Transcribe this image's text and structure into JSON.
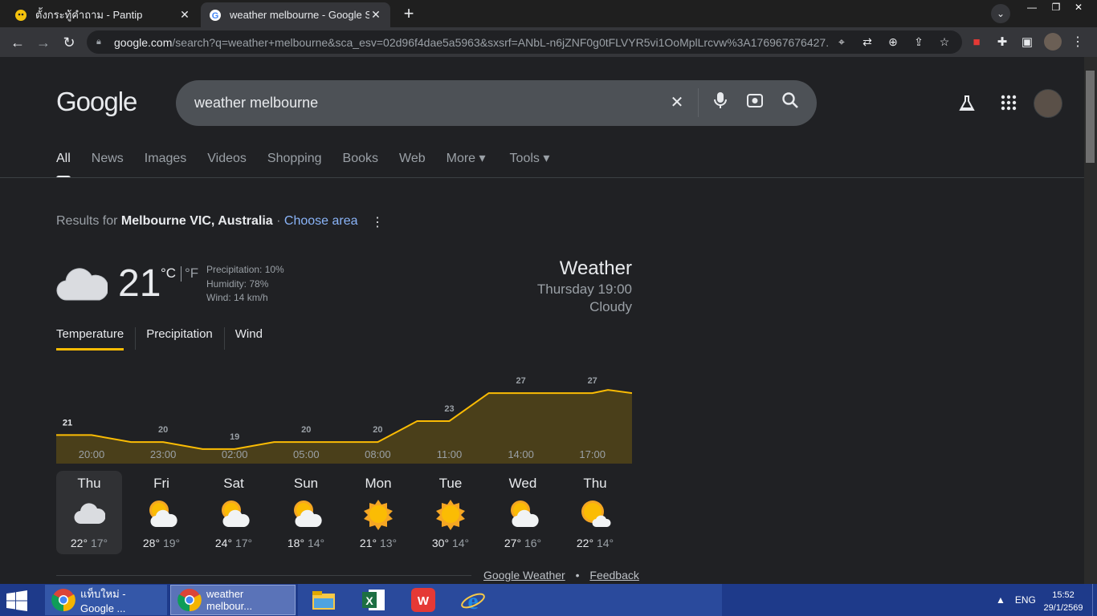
{
  "browser": {
    "tabs": [
      {
        "title": "ตั้งกระทู้คำถาม - Pantip",
        "close": "✕"
      },
      {
        "title": "weather melbourne - Google Sea",
        "close": "✕"
      }
    ],
    "new_tab": "+",
    "url_host": "google.com",
    "url_rest": "/search?q=weather+melbourne&sca_esv=02d96f4dae5a5963&sxsrf=ANbL-n6jZNF0g0tFLVYR5vi1OoMplLrcvw%3A176967676427..."
  },
  "google": {
    "logo": "Google",
    "query": "weather melbourne",
    "nav_tabs": [
      "All",
      "News",
      "Images",
      "Videos",
      "Shopping",
      "Books",
      "Web",
      "More ▾",
      "Tools ▾"
    ],
    "active_tab": "All"
  },
  "location": {
    "prefix": "Results for ",
    "place": "Melbourne VIC, Australia",
    "separator": " · ",
    "choose": "Choose area"
  },
  "weather": {
    "temp": "21",
    "unit_c": "°C",
    "unit_f": "°F",
    "precipitation": "Precipitation: 10%",
    "humidity": "Humidity: 78%",
    "wind": "Wind: 14 km/h",
    "title": "Weather",
    "datetime": "Thursday 19:00",
    "condition": "Cloudy",
    "metric_tabs": [
      "Temperature",
      "Precipitation",
      "Wind"
    ],
    "active_metric": "Temperature",
    "accent": "#fbbc04"
  },
  "chart_data": {
    "type": "area",
    "x": [
      "20:00",
      "23:00",
      "02:00",
      "05:00",
      "08:00",
      "11:00",
      "14:00",
      "17:00"
    ],
    "values": [
      21,
      20,
      19,
      20,
      20,
      23,
      27,
      27
    ],
    "ylim": [
      0,
      30
    ],
    "grid": false,
    "fill": "#4a3f1a",
    "line": "#fbbc04"
  },
  "forecast": [
    {
      "day": "Thu",
      "high": "22°",
      "low": "17°",
      "icon": "cloudy-icon"
    },
    {
      "day": "Fri",
      "high": "28°",
      "low": "19°",
      "icon": "partly-cloudy-icon"
    },
    {
      "day": "Sat",
      "high": "24°",
      "low": "17°",
      "icon": "partly-cloudy-icon"
    },
    {
      "day": "Sun",
      "high": "18°",
      "low": "14°",
      "icon": "partly-cloudy-icon"
    },
    {
      "day": "Mon",
      "high": "21°",
      "low": "13°",
      "icon": "sunny-icon"
    },
    {
      "day": "Tue",
      "high": "30°",
      "low": "14°",
      "icon": "sunny-icon"
    },
    {
      "day": "Wed",
      "high": "27°",
      "low": "16°",
      "icon": "partly-cloudy-icon"
    },
    {
      "day": "Thu",
      "high": "22°",
      "low": "14°",
      "icon": "mostly-sunny-icon"
    }
  ],
  "footer": {
    "source": "Google Weather",
    "dot": "•",
    "feedback": "Feedback"
  },
  "taskbar": {
    "items": [
      "แท็บใหม่ - Google ...",
      "weather melbour..."
    ],
    "lang": "ENG",
    "time": "15:52",
    "date": "29/1/2569"
  }
}
